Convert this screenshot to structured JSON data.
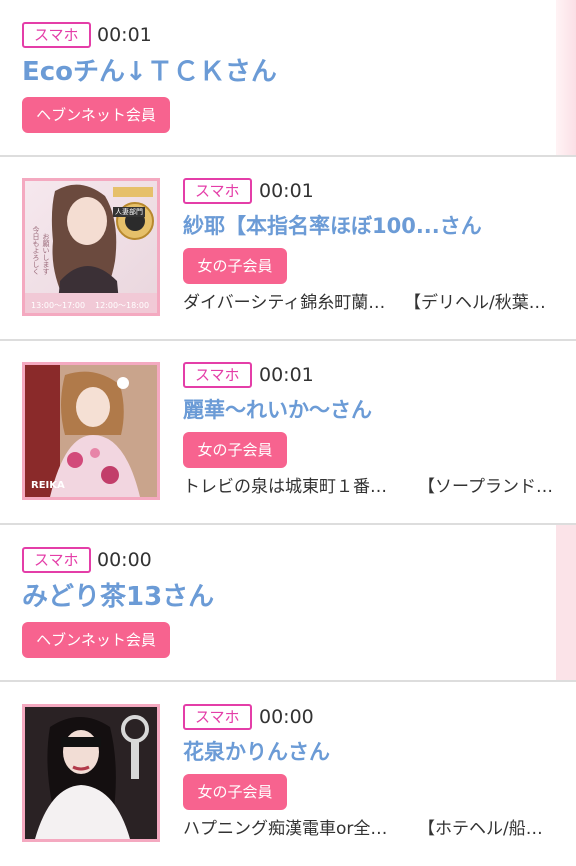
{
  "items": [
    {
      "device": "スマホ",
      "time": "00:01",
      "name": "Ecoチん↓ＴＣＫさん",
      "member": "ヘブンネット会員"
    },
    {
      "device": "スマホ",
      "time": "00:01",
      "name": "紗耶【本指名率ほぼ100...さん",
      "member": "女の子会員",
      "shop": "ダイバーシティ錦糸町蘭…",
      "genre": "【デリヘル/秋葉…",
      "thumb_text": {
        "label": "人妻部門",
        "line1": "今日もよろしく",
        "line2": "お願いします",
        "time1": "13:00〜17:00",
        "time2": "12:00〜18:00"
      }
    },
    {
      "device": "スマホ",
      "time": "00:01",
      "name": "麗華〜れいか〜さん",
      "member": "女の子会員",
      "shop": "トレビの泉は城東町１番…",
      "genre": "【ソープランド…",
      "thumb_text": {
        "label": "REIKA"
      }
    },
    {
      "device": "スマホ",
      "time": "00:00",
      "name": "みどり茶13さん",
      "member": "ヘブンネット会員"
    },
    {
      "device": "スマホ",
      "time": "00:00",
      "name": "花泉かりんさん",
      "member": "女の子会員",
      "shop": "ハプニング痴漢電車or全…",
      "genre": "【ホテヘル/船…"
    }
  ],
  "colors": {
    "badge": "#e43ea8",
    "name": "#6b9bd6",
    "member_button": "#f7638f",
    "thumb_border": "#f4a9c0"
  }
}
